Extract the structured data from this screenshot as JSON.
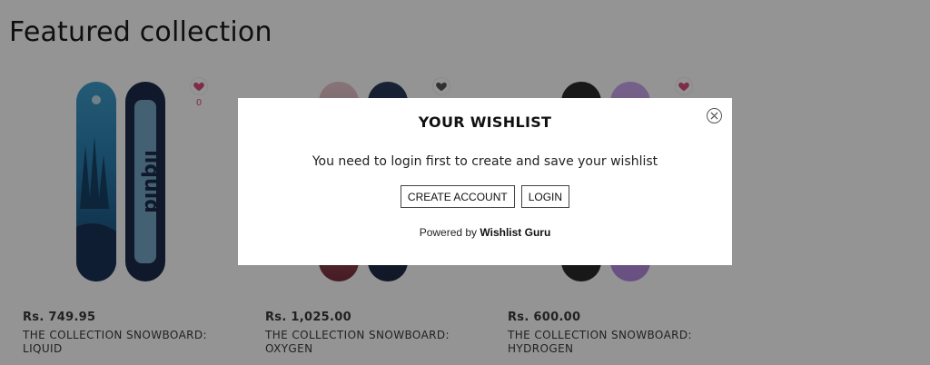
{
  "section": {
    "title": "Featured collection"
  },
  "products": [
    {
      "price": "Rs. 749.95",
      "name": "THE COLLECTION SNOWBOARD: LIQUID",
      "wishlist_count": "0",
      "heart_color": "#d94f7c",
      "board_colors": [
        "#2a7fb0",
        "#1d2a4a"
      ]
    },
    {
      "price": "Rs. 1,025.00",
      "name": "THE COLLECTION SNOWBOARD: OXYGEN",
      "wishlist_count": "",
      "heart_color": "#555555",
      "board_colors": [
        "#c08a96",
        "#1e2a44"
      ]
    },
    {
      "price": "Rs. 600.00",
      "name": "THE COLLECTION SNOWBOARD: HYDROGEN",
      "wishlist_count": "",
      "heart_color": "#d94f7c",
      "board_colors": [
        "#2a2a2a",
        "#b58be0"
      ]
    }
  ],
  "modal": {
    "title": "YOUR WISHLIST",
    "message": "You need to login first to create and save your wishlist",
    "create_account_label": "CREATE ACCOUNT",
    "login_label": "LOGIN",
    "powered_prefix": "Powered by",
    "powered_brand": "Wishlist Guru"
  },
  "icons": {
    "close": "close-circle-icon",
    "heart": "heart-icon"
  }
}
